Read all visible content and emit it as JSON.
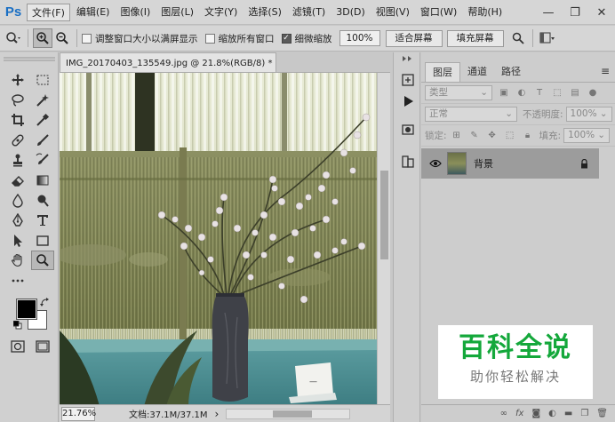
{
  "app": {
    "logo": "Ps"
  },
  "menu": [
    {
      "label": "文件(F)",
      "active": true
    },
    {
      "label": "编辑(E)"
    },
    {
      "label": "图像(I)"
    },
    {
      "label": "图层(L)"
    },
    {
      "label": "文字(Y)"
    },
    {
      "label": "选择(S)"
    },
    {
      "label": "滤镜(T)"
    },
    {
      "label": "3D(D)"
    },
    {
      "label": "视图(V)"
    },
    {
      "label": "窗口(W)"
    },
    {
      "label": "帮助(H)"
    }
  ],
  "window_controls": {
    "minimize": "—",
    "restore": "❐",
    "close": "✕"
  },
  "options": {
    "resize_windows": "调整窗口大小以满屏显示",
    "zoom_all_windows": "缩放所有窗口",
    "scrubby_zoom": "细微缩放",
    "zoom_value": "100%",
    "fit_screen": "适合屏幕",
    "fill_screen": "填充屏幕"
  },
  "document": {
    "tab_title": "IMG_20170403_135549.jpg @ 21.8%(RGB/8) *",
    "close": "×",
    "status_zoom": "21.76%",
    "status_doc": "文档:37.1M/37.1M",
    "status_arrow": "›"
  },
  "layers_panel": {
    "tabs": [
      "图层",
      "通道",
      "路径"
    ],
    "filter_kind": "类型",
    "blend_mode": "正常",
    "opacity_label": "不透明度:",
    "opacity_value": "100%",
    "lock_label": "锁定:",
    "fill_label": "填充:",
    "fill_value": "100%",
    "layer_name": "背景"
  },
  "watermark": {
    "title": "百科全说",
    "subtitle": "助你轻松解决"
  },
  "colors": {
    "foreground": "#000000",
    "background": "#ffffff",
    "ps_blue": "#1a6fc4",
    "watermark_green": "#14a83b"
  }
}
